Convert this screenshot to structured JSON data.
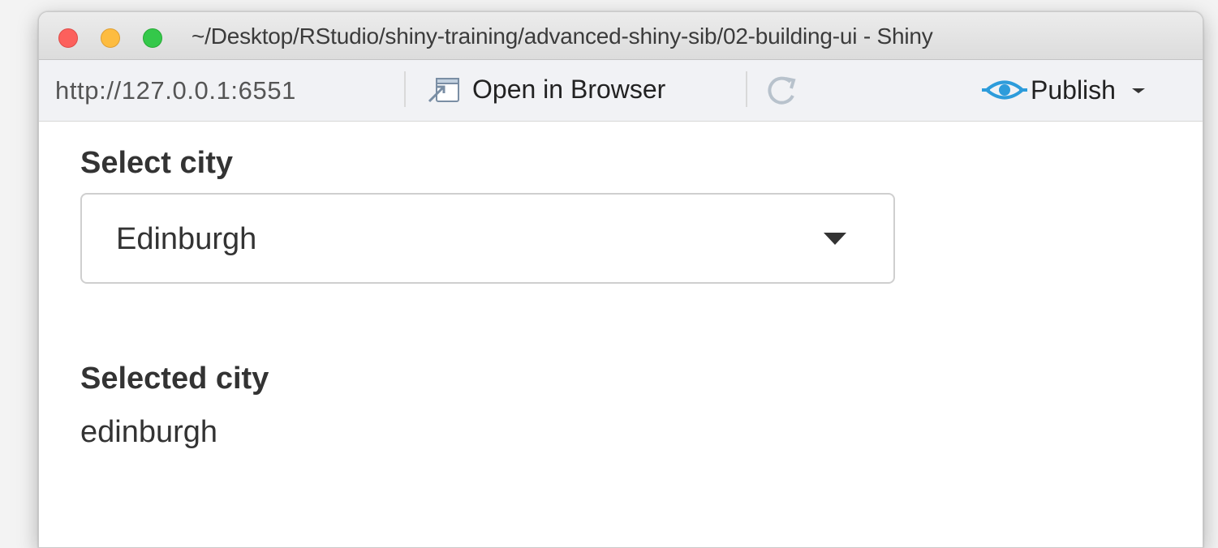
{
  "window": {
    "title": "~/Desktop/RStudio/shiny-training/advanced-shiny-sib/02-building-ui - Shiny"
  },
  "toolbar": {
    "url": "http://127.0.0.1:6551",
    "open_in_browser": "Open in Browser",
    "publish": "Publish",
    "icons": {
      "open": "open-in-browser-icon",
      "refresh": "refresh-icon",
      "publish": "publish-icon",
      "dropdown": "chevron-down-icon"
    }
  },
  "app": {
    "select_label": "Select city",
    "select_value": "Edinburgh",
    "output_label": "Selected city",
    "output_value": "edinburgh"
  },
  "colors": {
    "close": "#fc605c",
    "minimize": "#fdbc40",
    "maximize": "#34c84a",
    "publish_blue": "#2d9cdb",
    "text": "#333333"
  }
}
